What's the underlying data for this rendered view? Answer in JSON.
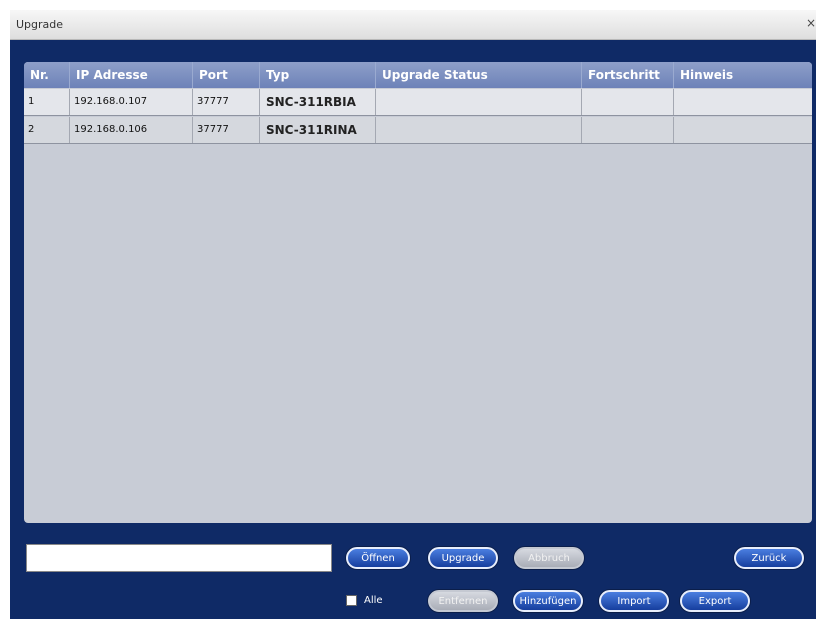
{
  "window": {
    "title": "Upgrade",
    "close_glyph": "×"
  },
  "table": {
    "columns": [
      "Nr.",
      "IP Adresse",
      "Port",
      "Typ",
      "Upgrade Status",
      "Fortschritt",
      "Hinweis"
    ],
    "rows": [
      {
        "nr": "1",
        "ip": "192.168.0.107",
        "port": "37777",
        "typ": "SNC-311RBIA",
        "status": "",
        "fortschritt": "",
        "hinweis": ""
      },
      {
        "nr": "2",
        "ip": "192.168.0.106",
        "port": "37777",
        "typ": "SNC-311RINA",
        "status": "",
        "fortschritt": "",
        "hinweis": ""
      }
    ]
  },
  "file_input": {
    "value": "",
    "placeholder": ""
  },
  "buttons": {
    "offnen": "Öffnen",
    "upgrade": "Upgrade",
    "abbruch": "Abbruch",
    "zuruck": "Zurück",
    "entfernen": "Entfernen",
    "hinzufugen": "Hinzufügen",
    "import": "Import",
    "export": "Export"
  },
  "alle": {
    "label": "Alle",
    "checked": false
  },
  "colors": {
    "window_bg": "#0f2a66",
    "table_header": "#7a8dbe",
    "table_body": "#c8ccd6",
    "button_active": "#2a5bc4",
    "button_disabled": "#bfc3cc"
  }
}
